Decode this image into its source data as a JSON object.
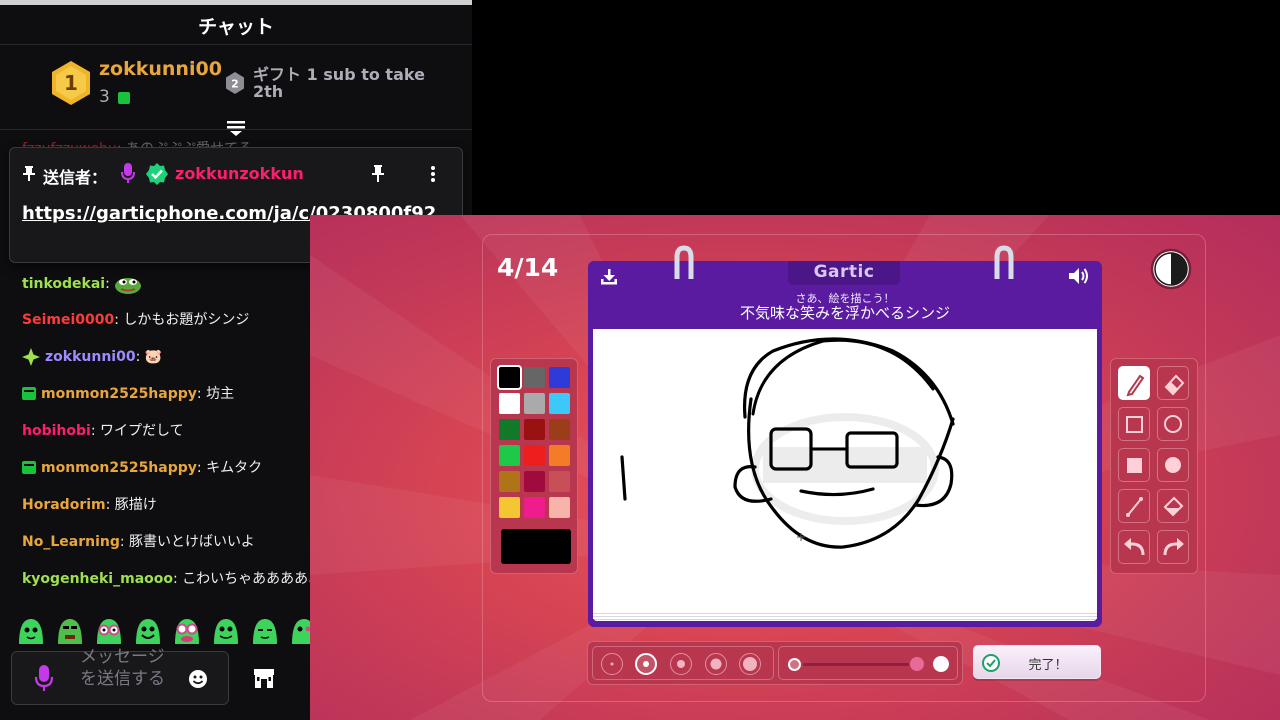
{
  "chat": {
    "title": "チャット",
    "leaderboard": {
      "first_name": "zokkunni00",
      "first_rank": "1",
      "first_count": "3",
      "second_rank": "2",
      "gift_text": "ギフト 1 sub to take 2th"
    },
    "hidden_message_user": "fzzufzzuwehu",
    "hidden_message_text": ": あのぷぷぷ愛せてる",
    "pinned": {
      "label": "送信者：",
      "user": "zokkunzokkun",
      "link": "https://garticphone.com/ja/c/0230800f92"
    },
    "messages": [
      {
        "user": "tinkodekai",
        "color": "#9ee04e",
        "text": "",
        "icon": "",
        "emote": true
      },
      {
        "user": "Seimei0000",
        "color": "#ff3a3a",
        "text": "しかもお題がシンジ",
        "icon": "",
        "emote": false
      },
      {
        "user": "zokkunni00",
        "color": "#9c8cff",
        "text": "🐷",
        "icon": "sparkle",
        "emote": false
      },
      {
        "user": "monmon2525happy",
        "color": "#e8a63c",
        "text": "坊主",
        "icon": "sub",
        "emote": false
      },
      {
        "user": "hobihobi",
        "color": "#ff1e6b",
        "text": "ワイプだして",
        "icon": "",
        "emote": false
      },
      {
        "user": "monmon2525happy",
        "color": "#e8a63c",
        "text": "キムタク",
        "icon": "sub",
        "emote": false
      },
      {
        "user": "Horadorim",
        "color": "#e8a63c",
        "text": "豚描け",
        "icon": "",
        "emote": false
      },
      {
        "user": "No_Learning",
        "color": "#e8a63c",
        "text": "豚書いとけばいいよ",
        "icon": "",
        "emote": false
      },
      {
        "user": "kyogenheki_maooo",
        "color": "#9ee04e",
        "text": "こわいちゃああああああ",
        "icon": "",
        "emote": false
      }
    ],
    "input_placeholder": "メッセージを送信する"
  },
  "game": {
    "round": "4/14",
    "logo": "Gartic",
    "subtitle": "さあ、絵を描こう！",
    "prompt": "不気味な笑みを浮かべるシンジ",
    "done_label": "完了！",
    "palette": [
      "#000000",
      "#666666",
      "#2f3bd9",
      "#ffffff",
      "#aaaaaa",
      "#3cc8f8",
      "#117a2a",
      "#991111",
      "#9a3e1a",
      "#1ec848",
      "#ee1e1e",
      "#f47c28",
      "#b07418",
      "#a00a3c",
      "#c84e58",
      "#f4c634",
      "#ee1c8c",
      "#f8b4a8"
    ],
    "current_color": "#000000",
    "brush_size_selected": 2,
    "opacity": 0.8
  }
}
